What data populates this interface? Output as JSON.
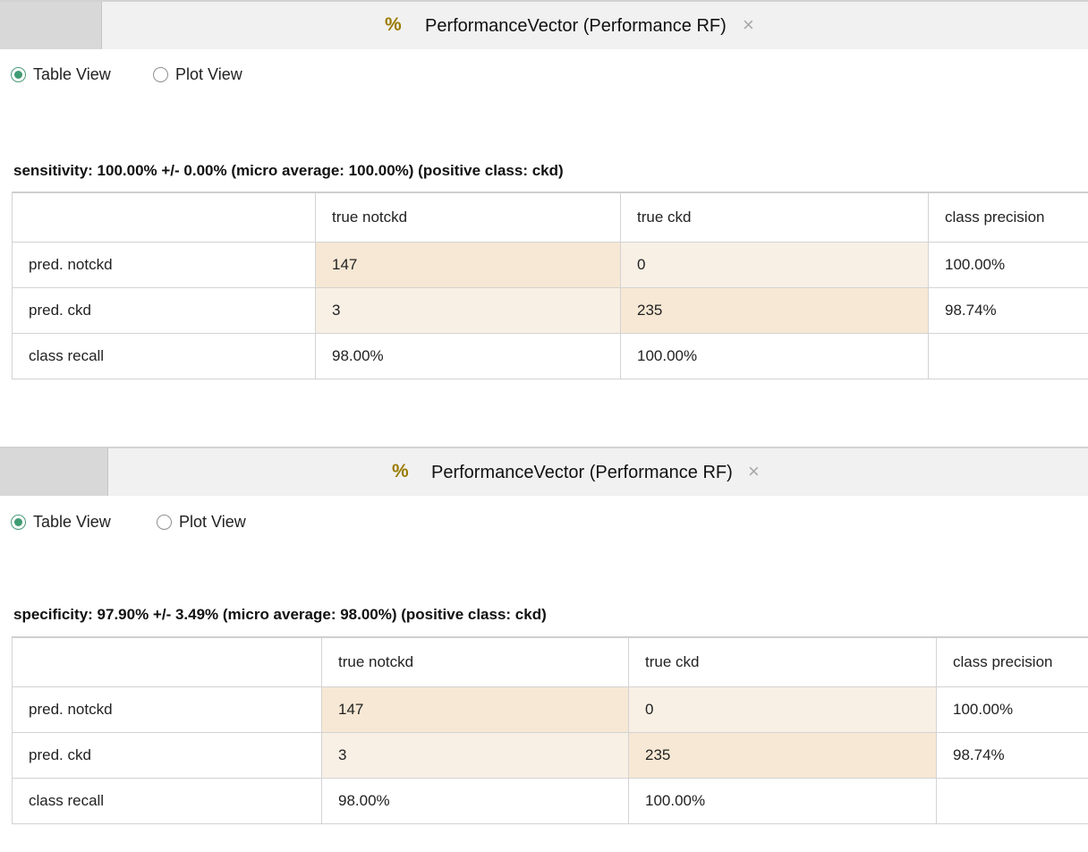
{
  "panels": [
    {
      "tab": {
        "title": "PerformanceVector (Performance RF)",
        "icon": "percent-icon"
      },
      "views": {
        "table": "Table View",
        "plot": "Plot View",
        "selected": "table"
      },
      "heading": "sensitivity: 100.00% +/- 0.00% (micro average: 100.00%) (positive class: ckd)",
      "table": {
        "columns": [
          "",
          "true notckd",
          "true ckd",
          "class precision"
        ],
        "rows": [
          [
            "pred. notckd",
            "147",
            "0",
            "100.00%"
          ],
          [
            "pred. ckd",
            "3",
            "235",
            "98.74%"
          ],
          [
            "class recall",
            "98.00%",
            "100.00%",
            ""
          ]
        ]
      }
    },
    {
      "tab": {
        "title": "PerformanceVector (Performance RF)",
        "icon": "percent-icon"
      },
      "views": {
        "table": "Table View",
        "plot": "Plot View",
        "selected": "table"
      },
      "heading": "specificity: 97.90% +/- 3.49% (micro average: 98.00%) (positive class: ckd)",
      "table": {
        "columns": [
          "",
          "true notckd",
          "true ckd",
          "class precision"
        ],
        "rows": [
          [
            "pred. notckd",
            "147",
            "0",
            "100.00%"
          ],
          [
            "pred. ckd",
            "3",
            "235",
            "98.74%"
          ],
          [
            "class recall",
            "98.00%",
            "100.00%",
            ""
          ]
        ]
      }
    }
  ],
  "colors": {
    "cell_high": "#f6e8d4",
    "cell_low": "#f8f0e5",
    "radio_selected": "#3f9c73"
  }
}
